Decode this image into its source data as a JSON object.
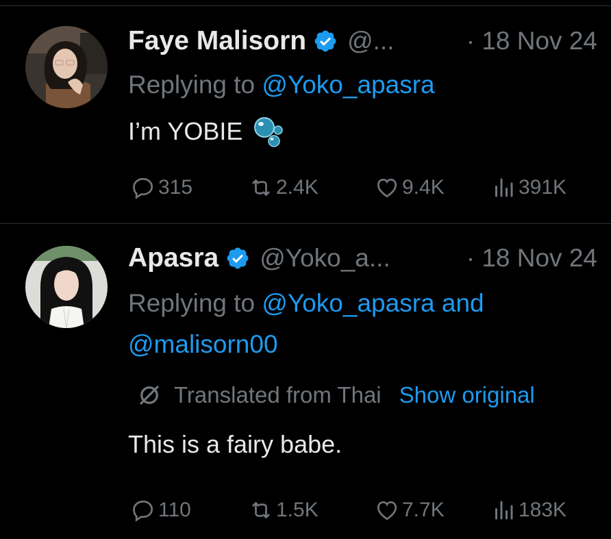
{
  "colors": {
    "background": "#000000",
    "primary_text": "#e7e9ea",
    "secondary_text": "#71767b",
    "link": "#1d9bf0",
    "divider": "#2f3336",
    "verified": "#1d9bf0"
  },
  "tweets": [
    {
      "author": {
        "name": "Faye Malisorn",
        "handle": "@...",
        "verified": true
      },
      "time": "· 18 Nov 24",
      "replying": {
        "prefix": "Replying to ",
        "mentions": "@Yoko_apasra"
      },
      "text": "I’m YOBIE",
      "emoji": "bubbles-icon",
      "stats": {
        "replies": "315",
        "reposts": "2.4K",
        "likes": "9.4K",
        "views": "391K"
      }
    },
    {
      "author": {
        "name": "Apasra",
        "handle": "@Yoko_a...",
        "verified": true
      },
      "time": "· 18 Nov 24",
      "replying": {
        "prefix": "Replying to ",
        "mentions": "@Yoko_apasra and @malisorn00"
      },
      "translation": {
        "label": "Translated from Thai",
        "link": "Show original"
      },
      "text": "This is a fairy babe.",
      "stats": {
        "replies": "110",
        "reposts": "1.5K",
        "likes": "7.7K",
        "views": "183K"
      }
    }
  ]
}
